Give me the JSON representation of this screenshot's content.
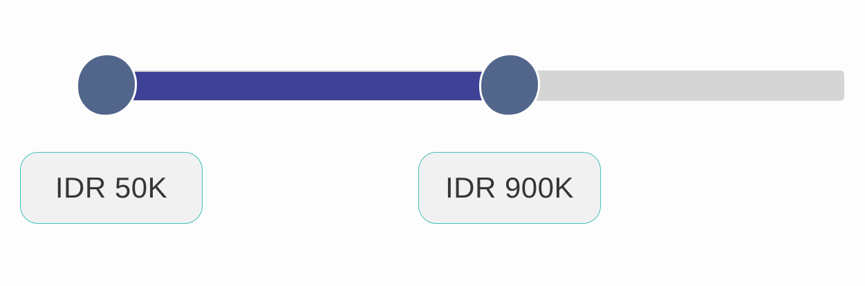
{
  "range_slider": {
    "currency": "IDR",
    "min_label": "IDR 50K",
    "max_label": "IDR 900K",
    "selected_range_fraction": [
      0.0,
      0.54
    ],
    "colors": {
      "fill": "#3f4196",
      "track": "#d5d5d5",
      "thumb": "#52668b",
      "label_border": "#3ec3b3",
      "label_background": "#f1f1f1",
      "label_text": "#353535"
    }
  }
}
